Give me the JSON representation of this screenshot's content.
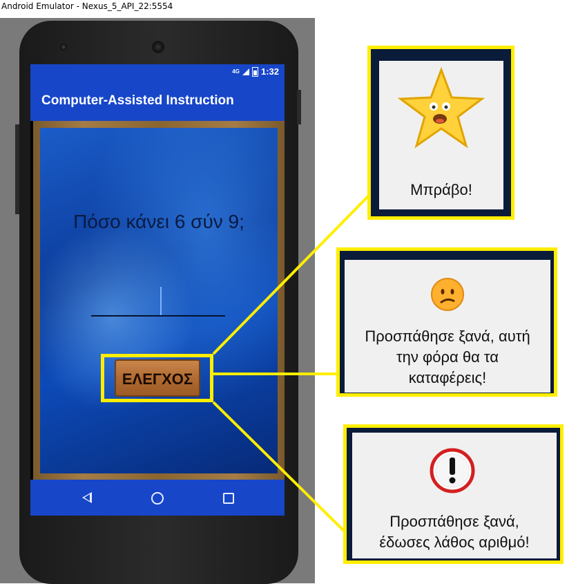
{
  "window": {
    "title": "Android Emulator - Nexus_5_API_22:5554"
  },
  "statusbar": {
    "network": "4G",
    "time": "1:32"
  },
  "app": {
    "title": "Computer-Assisted Instruction"
  },
  "quiz": {
    "question": "Πόσο κάνει 6 σύν 9;",
    "answer_value": "",
    "check_button_label": "ΕΛΕΓΧΟΣ"
  },
  "navbar": {
    "icons": [
      "back-icon",
      "home-icon",
      "recents-icon"
    ]
  },
  "popups": {
    "correct": {
      "icon": "smiling-star-icon",
      "message": "Μπράβο!"
    },
    "wrong": {
      "icon": "sad-face-icon",
      "line1": "Προσπάθησε ξανά, αυτή",
      "line2": "την φόρα θα τα",
      "line3": "καταφέρεις!"
    },
    "invalid": {
      "icon": "exclamation-icon",
      "line1": "Προσπάθησε ξανά,",
      "line2": "έδωσες λάθος αριθμό!"
    }
  },
  "colors": {
    "highlight": "#ffee00",
    "appbar": "#1746c9"
  }
}
